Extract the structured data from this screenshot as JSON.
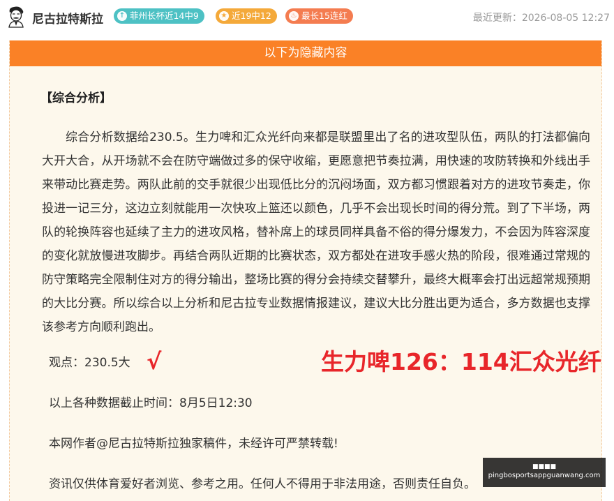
{
  "header": {
    "author_name": "尼古拉特斯拉",
    "badges": [
      {
        "icon": "arrow-up-icon",
        "label": "菲州长杯近14中9",
        "color": "#4dc1c4"
      },
      {
        "icon": "star-icon",
        "label": "近19中12",
        "color": "#f4a93a"
      },
      {
        "icon": "flame-icon",
        "label": "最长15连红",
        "color": "#f47c50"
      }
    ],
    "updated": "最近更新：2026-08-05 12:27"
  },
  "panel": {
    "banner": "以下为隐藏内容",
    "section_title": "【综合分析】",
    "analysis": "综合分析数据给230.5。生力啤和汇众光纤向来都是联盟里出了名的进攻型队伍，两队的打法都偏向大开大合，从开场就不会在防守端做过多的保守收缩，更愿意把节奏拉满，用快速的攻防转换和外线出手来带动比赛走势。两队此前的交手就很少出现低比分的沉闷场面，双方都习惯跟着对方的进攻节奏走，你投进一记三分，这边立刻就能用一次快攻上篮还以颜色，几乎不会出现长时间的得分荒。到了下半场，两队的轮换阵容也延续了主力的进攻风格，替补席上的球员同样具备不俗的得分爆发力，不会因为阵容深度的变化就放慢进攻脚步。再结合两队近期的比赛状态，双方都处在进攻手感火热的阶段，很难通过常规的防守策略完全限制住对方的得分输出，整场比赛的得分会持续交替攀升，最终大概率会打出远超常规预期的大比分赛。所以综合以上分析和尼古拉专业数据情报建议，建议大比分胜出更为适合，多方数据也支撑该参考方向顺利跑出。",
    "viewpoint": "观点：230.5大",
    "check_mark": "√",
    "score": "生力啤126：114汇众光纤",
    "cutoff": "以上各种数据截止时间：8月5日12:30",
    "copyright": "本网作者@尼古拉特斯拉独家稿件，未经许可严禁转载!",
    "disclaimer": "资讯仅供体育爱好者浏览、参考之用。任何人不得用于非法用途，否则责任自负。"
  },
  "watermark": {
    "top": "■■■■",
    "url": "pingbosportsappguanwang.com"
  },
  "colors": {
    "accent_orange": "#fa8126",
    "highlight_red": "#e8262a",
    "panel_bg": "#fdf8ec"
  }
}
